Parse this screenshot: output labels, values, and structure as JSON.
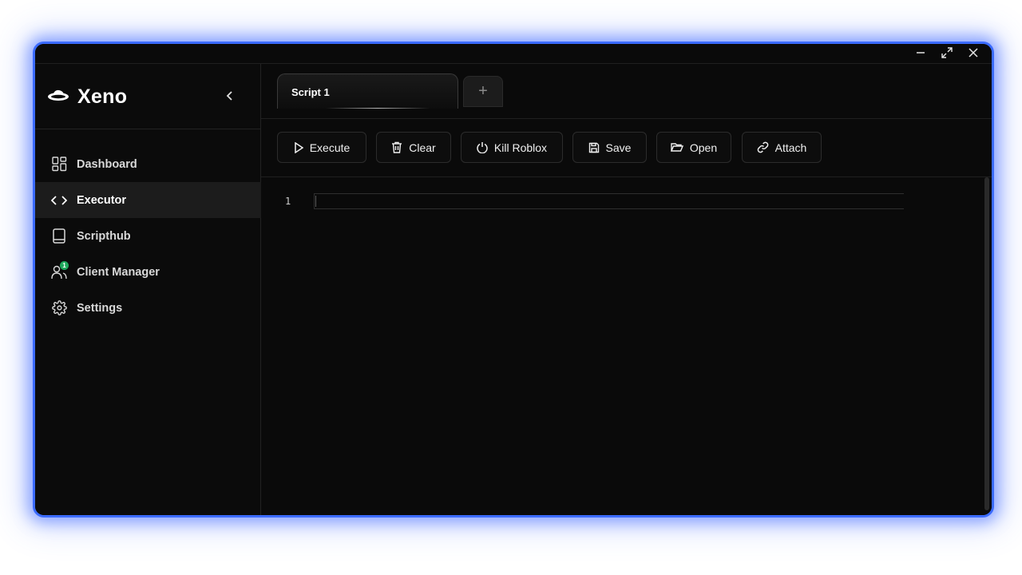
{
  "app": {
    "name": "Xeno"
  },
  "window_controls": [
    "minimize-icon",
    "maximize-icon",
    "close-icon"
  ],
  "sidebar": {
    "items": [
      {
        "label": "Dashboard",
        "icon": "dashboard-icon",
        "active": false
      },
      {
        "label": "Executor",
        "icon": "code-icon",
        "active": true
      },
      {
        "label": "Scripthub",
        "icon": "book-icon",
        "active": false
      },
      {
        "label": "Client Manager",
        "icon": "users-icon",
        "active": false,
        "badge": "1"
      },
      {
        "label": "Settings",
        "icon": "gear-icon",
        "active": false
      }
    ]
  },
  "tabs": [
    {
      "label": "Script 1"
    }
  ],
  "add_tab_label": "+",
  "toolbar": {
    "execute": "Execute",
    "clear": "Clear",
    "kill": "Kill Roblox",
    "save": "Save",
    "open": "Open",
    "attach": "Attach"
  },
  "editor": {
    "line_numbers": [
      "1"
    ],
    "content": ""
  },
  "colors": {
    "accent_border": "#3b6bff",
    "badge": "#1fa85c",
    "background": "#0a0a0a"
  }
}
